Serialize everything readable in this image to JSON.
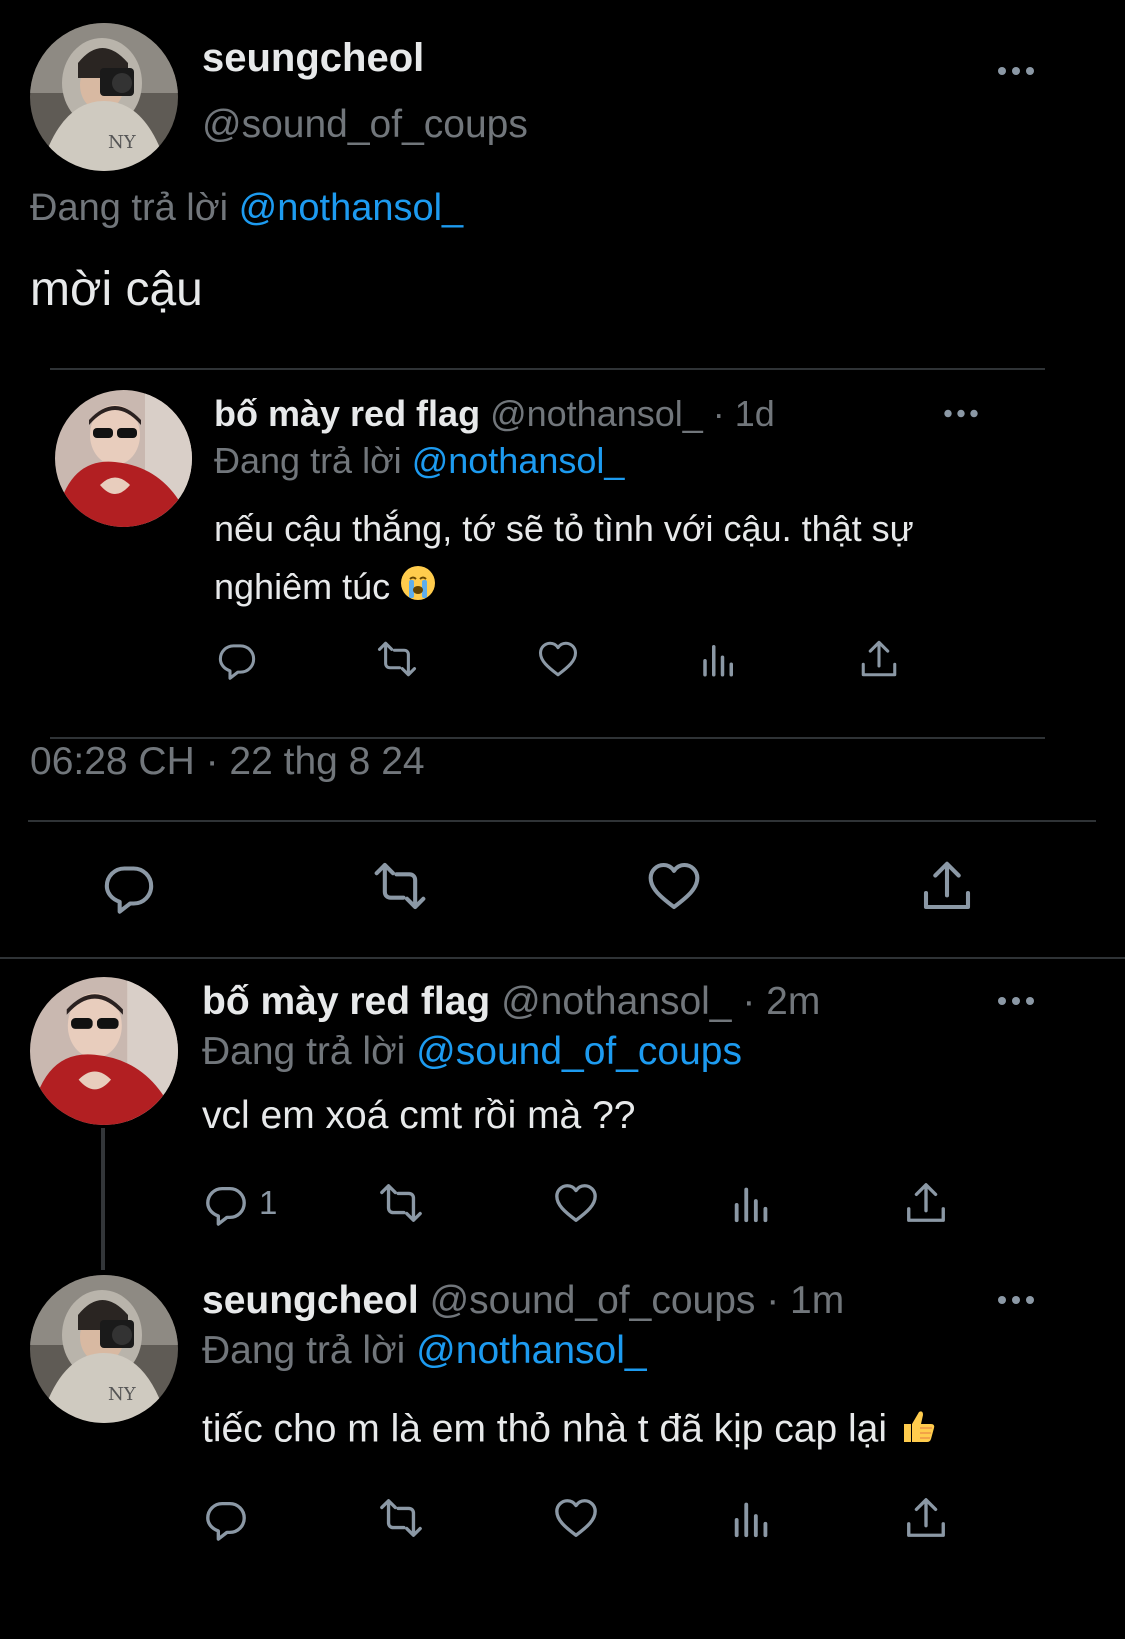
{
  "main_tweet": {
    "display_name": "seungcheol",
    "handle": "@sound_of_coups",
    "reply_prefix": "Đang trả lời",
    "reply_to": "@nothansol_",
    "text": "mời cậu",
    "timestamp": "06:28 CH · 22 thg 8 24"
  },
  "quoted_tweet": {
    "display_name": "bố mày red flag",
    "handle": "@nothansol_",
    "time": "· 1d",
    "reply_prefix": "Đang trả lời",
    "reply_to": "@nothansol_",
    "text_line1": "nếu cậu thắng, tớ sẽ tỏ tình với cậu. thật sự",
    "text_line2": "nghiêm túc"
  },
  "reply1": {
    "display_name": "bố mày red flag",
    "handle": "@nothansol_",
    "time": "· 2m",
    "reply_prefix": "Đang trả lời",
    "reply_to": "@sound_of_coups",
    "text": "vcl em xoá cmt rồi mà ??",
    "reply_count": "1"
  },
  "reply2": {
    "display_name": "seungcheol",
    "handle": "@sound_of_coups",
    "time": "· 1m",
    "reply_prefix": "Đang trả lời",
    "reply_to": "@nothansol_",
    "text": "tiếc cho m là em thỏ nhà t đã kịp cap lại"
  },
  "icons": {
    "reply": "reply-icon",
    "retweet": "retweet-icon",
    "like": "heart-icon",
    "views": "views-icon",
    "share": "share-icon",
    "more": "more-icon",
    "crying": "crying-face-emoji",
    "thumbs": "thumbs-up-emoji"
  },
  "colors": {
    "background": "#000000",
    "text": "#e7e9ea",
    "muted": "#71767b",
    "link": "#1d9bf0",
    "divider": "#2f3336"
  }
}
